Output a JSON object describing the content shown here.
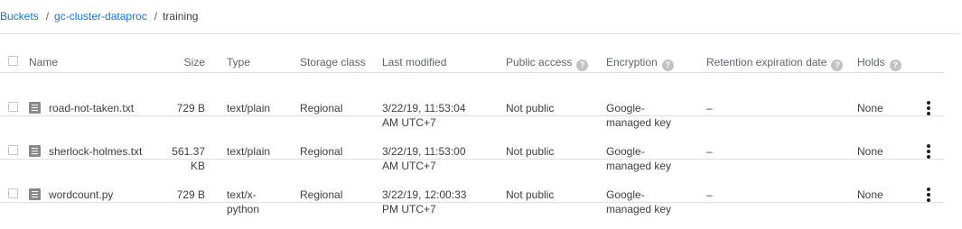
{
  "breadcrumb": {
    "items": [
      "Buckets",
      "gc-cluster-dataproc"
    ],
    "separator": "/",
    "current": "training"
  },
  "table": {
    "columns": {
      "name": "Name",
      "size": "Size",
      "type": "Type",
      "storage_class": "Storage class",
      "last_modified": "Last modified",
      "public_access": "Public access",
      "encryption": "Encryption",
      "retention": "Retention expiration date",
      "holds": "Holds"
    },
    "help_icon_glyph": "?",
    "rows": [
      {
        "name": "road-not-taken.txt",
        "size": [
          "729 B",
          ""
        ],
        "type": [
          "text/plain",
          ""
        ],
        "storage_class": "Regional",
        "last_modified": [
          "3/22/19, 11:53:04",
          "AM UTC+7"
        ],
        "public_access": "Not public",
        "encryption": [
          "Google-",
          "managed key"
        ],
        "retention": "–",
        "holds": "None"
      },
      {
        "name": "sherlock-holmes.txt",
        "size": [
          "561.37",
          "KB"
        ],
        "type": [
          "text/plain",
          ""
        ],
        "storage_class": "Regional",
        "last_modified": [
          "3/22/19, 11:53:00",
          "AM UTC+7"
        ],
        "public_access": "Not public",
        "encryption": [
          "Google-",
          "managed key"
        ],
        "retention": "–",
        "holds": "None"
      },
      {
        "name": "wordcount.py",
        "size": [
          "729 B",
          ""
        ],
        "type": [
          "text/x-",
          "python"
        ],
        "storage_class": "Regional",
        "last_modified": [
          "3/22/19, 12:00:33",
          "PM UTC+7"
        ],
        "public_access": "Not public",
        "encryption": [
          "Google-",
          "managed key"
        ],
        "retention": "–",
        "holds": "None"
      }
    ]
  },
  "icons": {
    "file": "file-icon",
    "help": "help-circle-icon",
    "more": "more-vert-icon"
  }
}
